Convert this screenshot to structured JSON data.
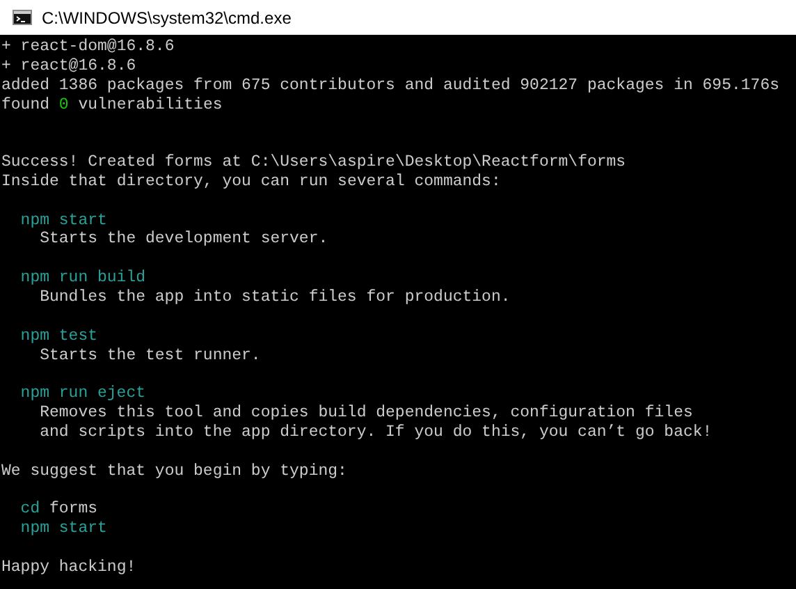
{
  "window": {
    "title": "C:\\WINDOWS\\system32\\cmd.exe"
  },
  "console": {
    "lines": [
      {
        "kind": "output",
        "segments": [
          {
            "text": "+ react-dom@16.8.6"
          }
        ]
      },
      {
        "kind": "output",
        "segments": [
          {
            "text": "+ react@16.8.6"
          }
        ]
      },
      {
        "kind": "output",
        "segments": [
          {
            "text": "added 1386 packages from 675 contributors and audited 902127 packages in 695.176s"
          }
        ]
      },
      {
        "kind": "output",
        "segments": [
          {
            "text": "found "
          },
          {
            "text": "0",
            "color": "#16c60c"
          },
          {
            "text": " vulnerabilities"
          }
        ]
      },
      {
        "kind": "blank"
      },
      {
        "kind": "blank"
      },
      {
        "kind": "output",
        "segments": [
          {
            "text": "Success! Created forms at C:\\Users\\aspire\\Desktop\\Reactform\\forms"
          }
        ]
      },
      {
        "kind": "output",
        "segments": [
          {
            "text": "Inside that directory, you can run several commands:"
          }
        ]
      },
      {
        "kind": "blank"
      },
      {
        "kind": "command",
        "segments": [
          {
            "text": "npm start",
            "color": "#2aa198"
          }
        ]
      },
      {
        "kind": "description",
        "segments": [
          {
            "text": "Starts the development server."
          }
        ]
      },
      {
        "kind": "blank"
      },
      {
        "kind": "command",
        "segments": [
          {
            "text": "npm run build",
            "color": "#2aa198"
          }
        ]
      },
      {
        "kind": "description",
        "segments": [
          {
            "text": "Bundles the app into static files for production."
          }
        ]
      },
      {
        "kind": "blank"
      },
      {
        "kind": "command",
        "segments": [
          {
            "text": "npm test",
            "color": "#2aa198"
          }
        ]
      },
      {
        "kind": "description",
        "segments": [
          {
            "text": "Starts the test runner."
          }
        ]
      },
      {
        "kind": "blank"
      },
      {
        "kind": "command",
        "segments": [
          {
            "text": "npm run eject",
            "color": "#2aa198"
          }
        ]
      },
      {
        "kind": "description",
        "segments": [
          {
            "text": "Removes this tool and copies build dependencies, configuration files"
          }
        ]
      },
      {
        "kind": "description",
        "segments": [
          {
            "text": "and scripts into the app directory. If you do this, you can’t go back!"
          }
        ]
      },
      {
        "kind": "blank"
      },
      {
        "kind": "output",
        "segments": [
          {
            "text": "We suggest that you begin by typing:"
          }
        ]
      },
      {
        "kind": "blank"
      },
      {
        "kind": "command",
        "segments": [
          {
            "text": "cd",
            "color": "#2aa198"
          },
          {
            "text": " forms"
          }
        ]
      },
      {
        "kind": "command",
        "segments": [
          {
            "text": "npm start",
            "color": "#2aa198"
          }
        ]
      },
      {
        "kind": "blank"
      },
      {
        "kind": "output",
        "segments": [
          {
            "text": "Happy hacking!"
          }
        ]
      }
    ]
  }
}
